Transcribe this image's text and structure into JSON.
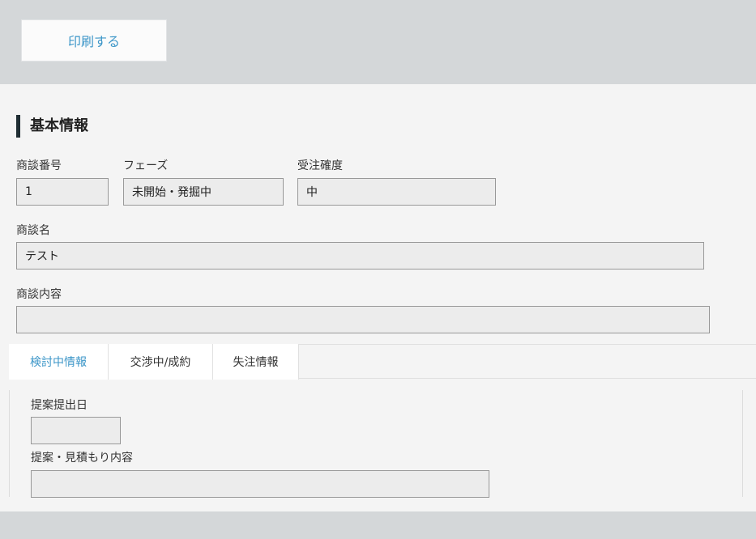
{
  "toolbar": {
    "print_label": "印刷する"
  },
  "basic_info": {
    "title": "基本情報",
    "deal_number": {
      "label": "商談番号",
      "value": "1"
    },
    "phase": {
      "label": "フェーズ",
      "value": "未開始・発掘中"
    },
    "order_probability": {
      "label": "受注確度",
      "value": "中"
    },
    "deal_name": {
      "label": "商談名",
      "value": "テスト"
    },
    "deal_content": {
      "label": "商談内容",
      "value": ""
    }
  },
  "tabs": [
    {
      "label": "検討中情報",
      "active": true
    },
    {
      "label": "交渉中/成約",
      "active": false
    },
    {
      "label": "失注情報",
      "active": false
    }
  ],
  "tab_content": {
    "proposal_date": {
      "label": "提案提出日",
      "value": ""
    },
    "proposal_content": {
      "label": "提案・見積もり内容",
      "value": ""
    }
  },
  "colors": {
    "accent": "#3c96c8",
    "heading_bar": "#1f2d33",
    "page_bg": "#d4d7d9",
    "panel_bg": "#f4f4f4",
    "field_bg": "#ececec"
  }
}
